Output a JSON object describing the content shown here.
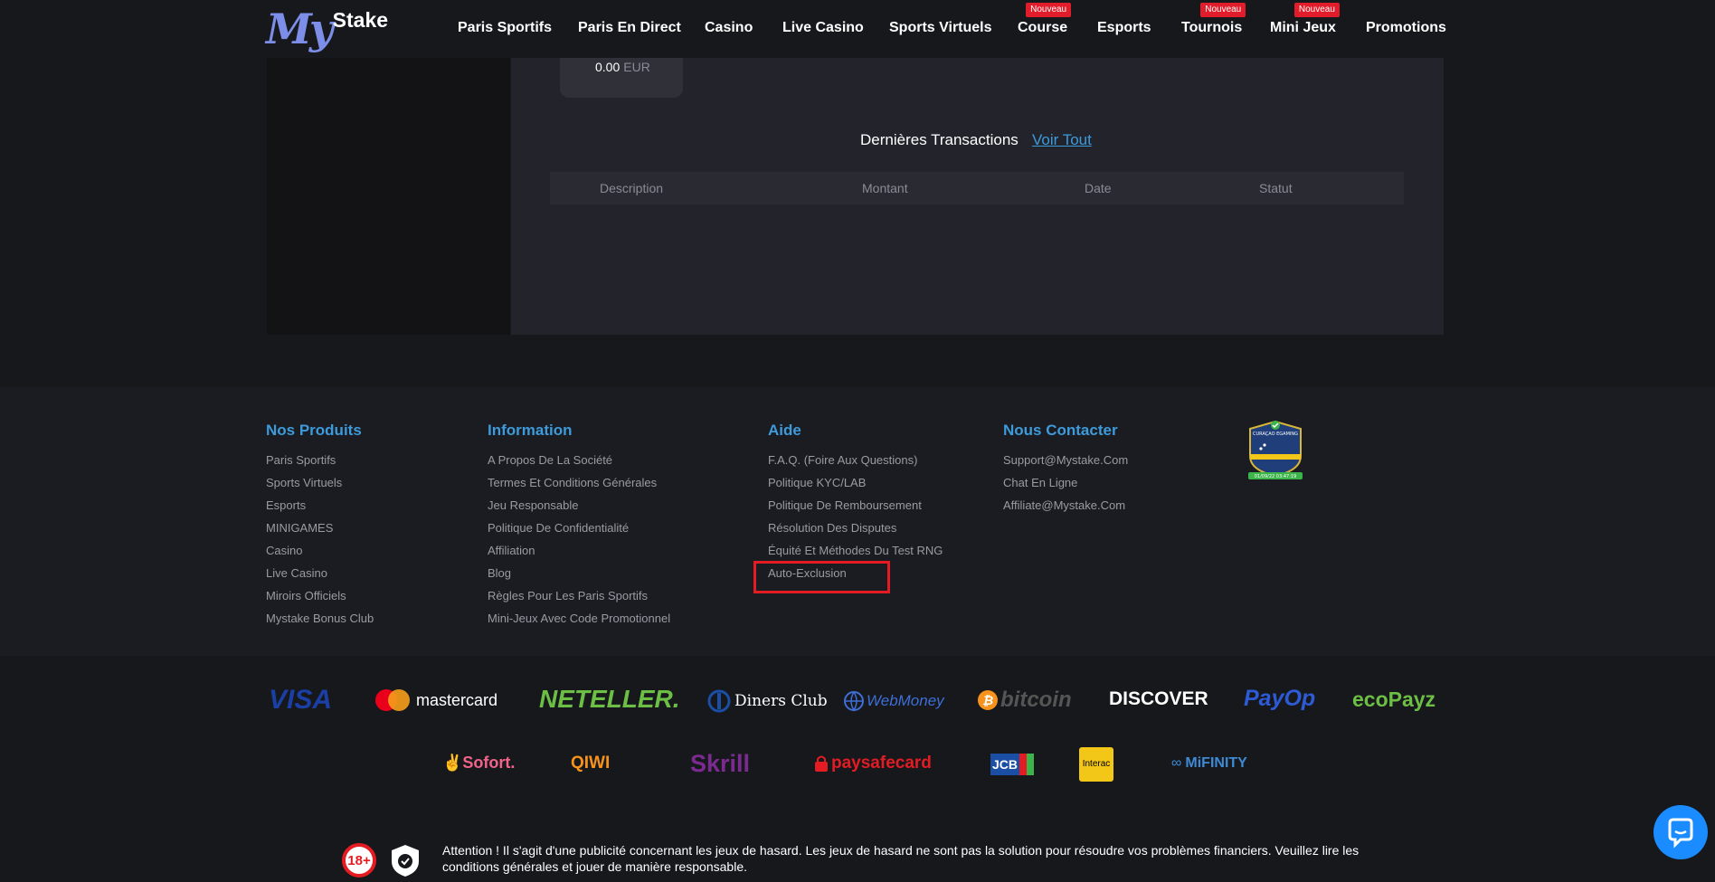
{
  "header": {
    "logo_my": "My",
    "logo_stake": "Stake",
    "nav": [
      {
        "label": "Paris Sportifs"
      },
      {
        "label": "Paris En Direct"
      },
      {
        "label": "Casino"
      },
      {
        "label": "Live Casino"
      },
      {
        "label": "Sports Virtuels"
      },
      {
        "label": "Course",
        "badge": "Nouveau"
      },
      {
        "label": "Esports"
      },
      {
        "label": "Tournois",
        "badge": "Nouveau"
      },
      {
        "label": "Mini Jeux",
        "badge": "Nouveau"
      },
      {
        "label": "Promotions"
      }
    ]
  },
  "account": {
    "balance_amount": "0.00",
    "balance_currency": "EUR",
    "transactions_title": "Dernières Transactions",
    "view_all": "Voir Tout",
    "columns": [
      "Description",
      "Montant",
      "Date",
      "Statut"
    ]
  },
  "footer": {
    "products": {
      "title": "Nos Produits",
      "links": [
        "Paris Sportifs",
        "Sports Virtuels",
        "Esports",
        "MINIGAMES",
        "Casino",
        "Live Casino",
        "Miroirs Officiels",
        "Mystake Bonus Club"
      ]
    },
    "information": {
      "title": "Information",
      "links": [
        "A Propos De La Société",
        "Termes Et Conditions Générales",
        "Jeu Responsable",
        "Politique De Confidentialité",
        "Affiliation",
        "Blog",
        "Règles Pour Les Paris Sportifs",
        "Mini-Jeux Avec Code Promotionnel"
      ]
    },
    "help": {
      "title": "Aide",
      "links": [
        "F.A.Q. (Foire Aux Questions)",
        "Politique KYC/LAB",
        "Politique De Remboursement",
        "Résolution Des Disputes",
        "Équité Et Méthodes Du Test RNG",
        "Auto-Exclusion"
      ]
    },
    "contact": {
      "title": "Nous Contacter",
      "links": [
        "Support@Mystake.Com",
        "Chat En Ligne",
        "Affiliate@Mystake.Com"
      ]
    },
    "seal_text": "CURAÇAO EGAMING",
    "seal_date": "01/09/22 03:47:19"
  },
  "payments": {
    "row1": [
      "VISA",
      "mastercard",
      "NETELLER.",
      "Diners Club",
      "WebMoney",
      "bitcoin",
      "DISCOVER",
      "PayOp",
      "ecoPayz"
    ],
    "row2": [
      "Sofort.",
      "QIWI",
      "Skrill",
      "paysafecard",
      "JCB",
      "Interac",
      "MiFINITY"
    ]
  },
  "disclaimer": {
    "age": "18+",
    "text": "Attention ! Il s'agit d'une publicité concernant les jeux de hasard. Les jeux de hasard ne sont pas la solution pour résoudre vos problèmes financiers. Veuillez lire les conditions générales et jouer de manière responsable."
  },
  "colors": {
    "accent": "#3d9bdc",
    "badge": "#e11d2b",
    "highlight": "#e31c23"
  }
}
